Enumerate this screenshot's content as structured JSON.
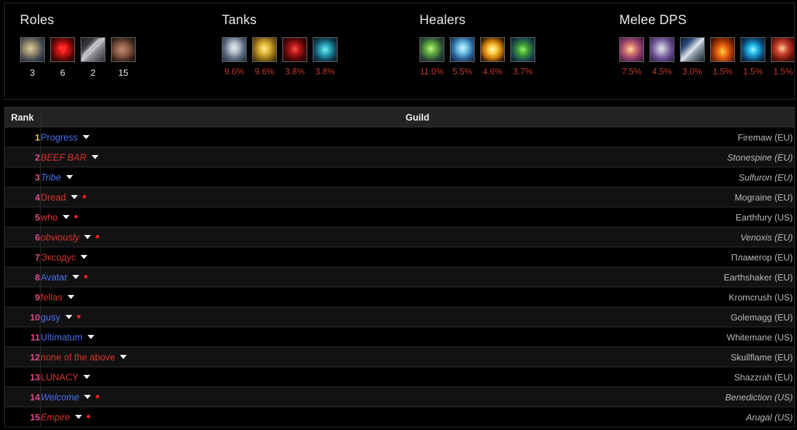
{
  "composition": {
    "groups": [
      {
        "title": "Roles",
        "kind": "count",
        "specs": [
          {
            "icon": "warrior-shield-icon",
            "art": "a-warr-shield",
            "value": "3"
          },
          {
            "icon": "healer-heart-icon",
            "art": "a-heart",
            "value": "6"
          },
          {
            "icon": "melee-sword-icon",
            "art": "a-sword",
            "value": "2"
          },
          {
            "icon": "ranged-bow-icon",
            "art": "a-bow",
            "value": "15"
          }
        ]
      },
      {
        "title": "Tanks",
        "kind": "percent",
        "specs": [
          {
            "icon": "protection-warrior-icon",
            "art": "a-shield-blue",
            "value": "9.6%"
          },
          {
            "icon": "protection-paladin-icon",
            "art": "a-shield-gold",
            "value": "9.6%"
          },
          {
            "icon": "demon-eyes-icon",
            "art": "a-demon-eyes",
            "value": "3.8%"
          },
          {
            "icon": "feral-bear-paw-icon",
            "art": "a-bear-paw",
            "value": "3.8%"
          }
        ]
      },
      {
        "title": "Healers",
        "kind": "percent",
        "specs": [
          {
            "icon": "restoration-hand-icon",
            "art": "a-hand-green",
            "value": "11.0%"
          },
          {
            "icon": "holy-priest-icon",
            "art": "a-spirit-blue",
            "value": "5.5%"
          },
          {
            "icon": "holy-flash-icon",
            "art": "a-holy-flash",
            "value": "4.6%"
          },
          {
            "icon": "restoration-leaf-icon",
            "art": "a-leaf-green",
            "value": "3.7%"
          }
        ]
      },
      {
        "title": "Melee DPS",
        "kind": "percent",
        "specs": [
          {
            "icon": "rogue-dagger-icon",
            "art": "a-rogue-dagger",
            "value": "7.5%"
          },
          {
            "icon": "warrior-mace-icon",
            "art": "a-warr-mace",
            "value": "4.5%"
          },
          {
            "icon": "axe-blue-icon",
            "art": "a-axe-blue",
            "value": "3.0%"
          },
          {
            "icon": "fury-flame-icon",
            "art": "a-fury-orange",
            "value": "1.5%"
          },
          {
            "icon": "shaman-lightning-icon",
            "art": "a-shaman-blue",
            "value": "1.5%"
          },
          {
            "icon": "red-claw-icon",
            "art": "a-red-claw",
            "value": "1.5%"
          }
        ]
      }
    ]
  },
  "table": {
    "headers": {
      "rank": "Rank",
      "guild": "Guild"
    },
    "rows": [
      {
        "rank": "1",
        "name": "Progress",
        "faction": "alliance",
        "italic": false,
        "dot": false,
        "realm": "Firemaw (EU)",
        "realm_italic": false
      },
      {
        "rank": "2",
        "name": "BEEF BAR",
        "faction": "horde",
        "italic": true,
        "dot": false,
        "realm": "Stonespine (EU)",
        "realm_italic": true
      },
      {
        "rank": "3",
        "name": "Tribe",
        "faction": "alliance",
        "italic": true,
        "dot": false,
        "realm": "Sulfuron (EU)",
        "realm_italic": true
      },
      {
        "rank": "4",
        "name": "Dread",
        "faction": "horde",
        "italic": false,
        "dot": true,
        "realm": "Mograine (EU)",
        "realm_italic": false
      },
      {
        "rank": "5",
        "name": "who",
        "faction": "horde",
        "italic": false,
        "dot": true,
        "realm": "Earthfury (US)",
        "realm_italic": false
      },
      {
        "rank": "6",
        "name": "obviously",
        "faction": "horde",
        "italic": true,
        "dot": true,
        "realm": "Venoxis (EU)",
        "realm_italic": true
      },
      {
        "rank": "7",
        "name": "Эксодус",
        "faction": "horde",
        "italic": false,
        "dot": false,
        "realm": "Пламегор (EU)",
        "realm_italic": false
      },
      {
        "rank": "8",
        "name": "Avatar",
        "faction": "alliance",
        "italic": false,
        "dot": true,
        "realm": "Earthshaker (EU)",
        "realm_italic": false
      },
      {
        "rank": "9",
        "name": "fellas",
        "faction": "horde",
        "italic": false,
        "dot": false,
        "realm": "Kromcrush (US)",
        "realm_italic": false
      },
      {
        "rank": "10",
        "name": "gusy",
        "faction": "alliance",
        "italic": false,
        "dot": true,
        "realm": "Golemagg (EU)",
        "realm_italic": false
      },
      {
        "rank": "11",
        "name": "Ultimatum",
        "faction": "alliance",
        "italic": false,
        "dot": false,
        "realm": "Whitemane (US)",
        "realm_italic": false
      },
      {
        "rank": "12",
        "name": "none of the above",
        "faction": "horde",
        "italic": false,
        "dot": false,
        "realm": "Skullflame (EU)",
        "realm_italic": false
      },
      {
        "rank": "13",
        "name": "LUNACY",
        "faction": "horde",
        "italic": false,
        "dot": false,
        "realm": "Shazzrah (EU)",
        "realm_italic": false
      },
      {
        "rank": "14",
        "name": "Welcome",
        "faction": "alliance",
        "italic": true,
        "dot": true,
        "realm": "Benediction (US)",
        "realm_italic": true
      },
      {
        "rank": "15",
        "name": "Empire",
        "faction": "horde",
        "italic": true,
        "dot": true,
        "realm": "Arugal (US)",
        "realm_italic": true
      }
    ]
  },
  "colors": {
    "alliance": "#4a6ff0",
    "horde": "#d9342b",
    "rank_top": "#e8c44a",
    "rank_other": "#e04a8a",
    "percent": "#c0392b",
    "realm": "#b9b9b9"
  }
}
